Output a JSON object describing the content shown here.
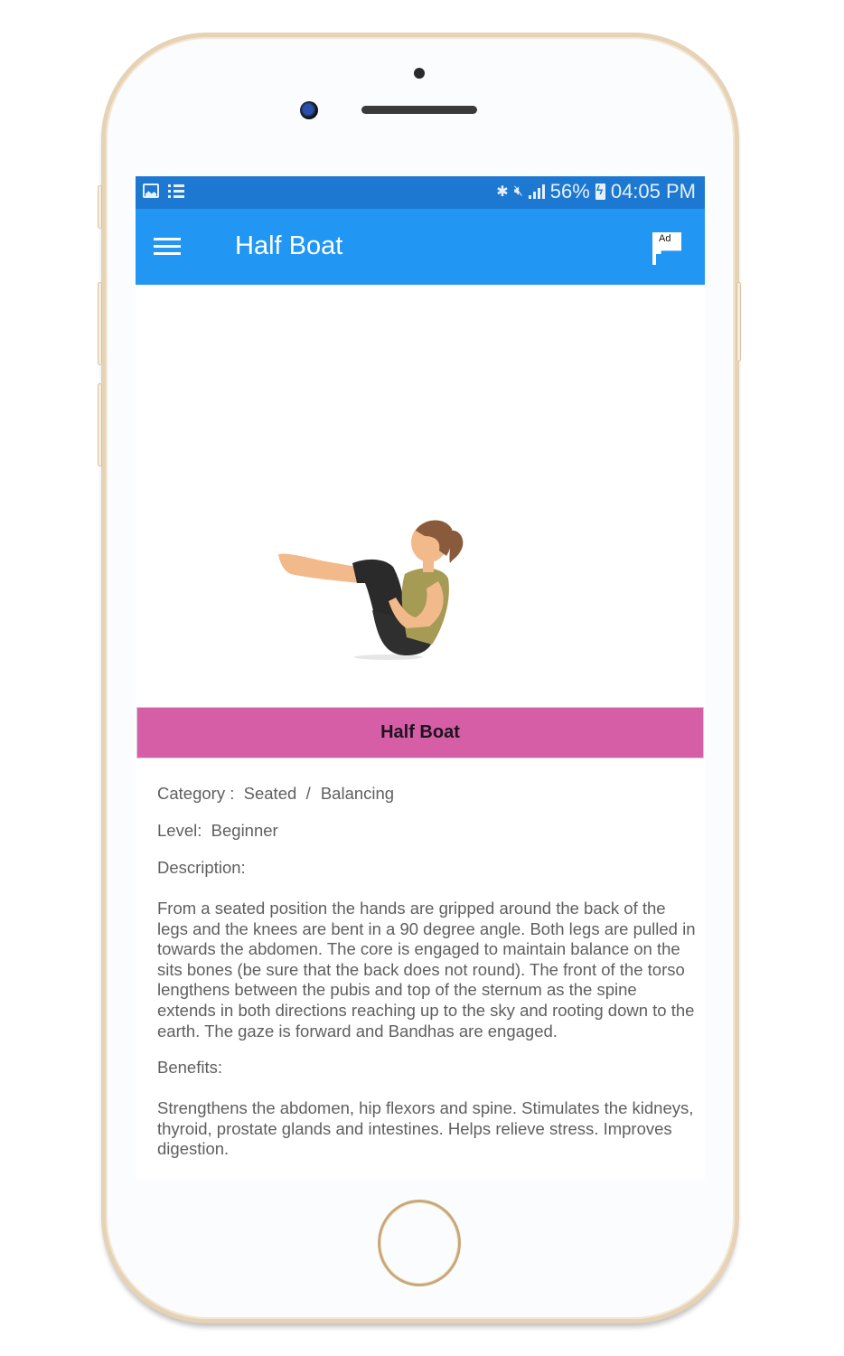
{
  "status_bar": {
    "left_icons": [
      "image-icon",
      "list-icon"
    ],
    "right_icons": [
      "bluetooth-icon",
      "mute-icon",
      "signal-icon",
      "battery-charging-icon"
    ],
    "battery": "56%",
    "time": "04:05 PM"
  },
  "app_bar": {
    "menu_icon": "hamburger-menu-icon",
    "title": "Half Boat",
    "ad_icon_label": "Ad"
  },
  "pose": {
    "image": "woman-half-boat-pose-illustration",
    "banner_title": "Half Boat",
    "category_label": "Category :",
    "category_values": [
      "Seated",
      "Balancing"
    ],
    "category_separator": "/",
    "level_label": "Level:",
    "level_value": "Beginner",
    "description_label": "Description:",
    "description": "From a seated position the hands are gripped around the back of the legs and the knees are bent in a 90 degree angle. Both legs are pulled in towards the abdomen. The core is engaged to maintain balance on the sits bones (be sure that the back does not round). The front of the torso lengthens between the pubis and top of the sternum as the spine extends in both directions reaching up to the sky and rooting down to the earth. The gaze is forward and Bandhas are engaged.",
    "benefits_label": "Benefits:",
    "benefits": "Strengthens the abdomen, hip flexors and spine. Stimulates the kidneys, thyroid, prostate glands and intestines. Helps relieve stress. Improves digestion."
  },
  "colors": {
    "status_bar": "#1d78d2",
    "app_bar": "#2196f3",
    "banner": "#d65ea6",
    "body_text": "#5f5f5f",
    "phone_frame": "#e6d2b5"
  }
}
